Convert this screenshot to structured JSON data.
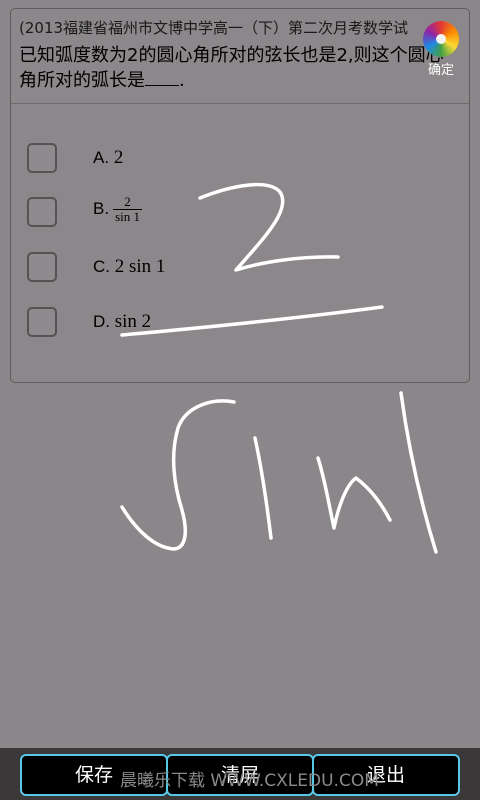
{
  "question": {
    "source": "(2013福建省福州市文博中学高一（下）第二次月考数学试",
    "text": "已知弧度数为2的圆心角所对的弦长也是2,则这个圆心角所对的弧长是",
    "end_punct": "."
  },
  "confirm": {
    "label": "确定",
    "icon": "color-wheel-icon"
  },
  "options": [
    {
      "letter": "A.",
      "value": "2"
    },
    {
      "letter": "B.",
      "numerator": "2",
      "denominator": "sin 1"
    },
    {
      "letter": "C.",
      "value": "2 sin 1"
    },
    {
      "letter": "D.",
      "value": "sin 2"
    }
  ],
  "bottombar": {
    "save": "保存",
    "clear": "清屏",
    "exit": "退出",
    "watermark": "晨曦乐下载 WWW.CXLEDU.COM"
  },
  "colors": {
    "background": "#8a8689",
    "ink": "#ffffff",
    "button_border": "#58c8e8",
    "button_fill": "#000000"
  }
}
